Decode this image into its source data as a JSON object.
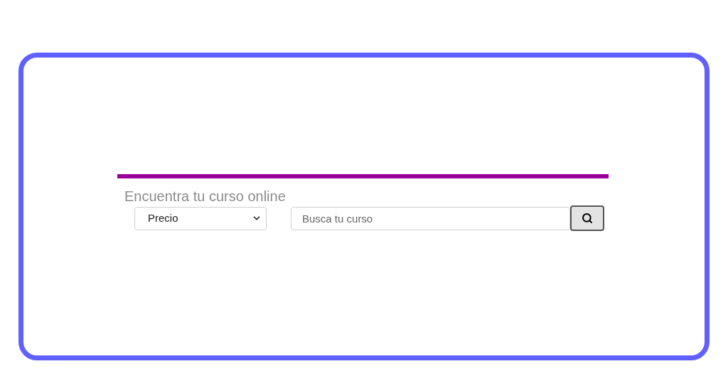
{
  "heading": "Encuentra tu curso online",
  "price_select": {
    "value": "Precio"
  },
  "search": {
    "placeholder": "Busca tu curso"
  }
}
